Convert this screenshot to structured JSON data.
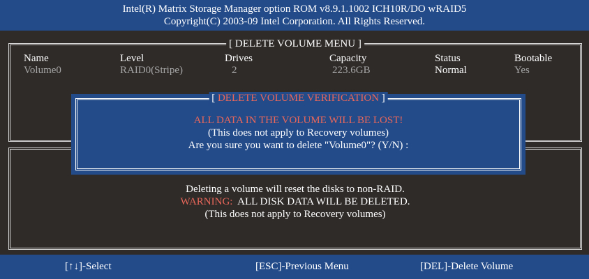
{
  "header": {
    "line1": "Intel(R) Matrix Storage Manager option ROM v8.9.1.1002 ICH10R/DO wRAID5",
    "line2": "Copyright(C) 2003-09 Intel Corporation.  All Rights Reserved."
  },
  "menu": {
    "title": "[ DELETE VOLUME MENU ]",
    "columns": {
      "name": "Name",
      "level": "Level",
      "drives": "Drives",
      "capacity": "Capacity",
      "status": "Status",
      "bootable": "Bootable"
    },
    "row": {
      "name": "Volume0",
      "level": "RAID0(Stripe)",
      "drives": "2",
      "capacity": "223.6GB",
      "status": "Normal",
      "bootable": "Yes"
    }
  },
  "dialog": {
    "bracket_open": "[ ",
    "title": "DELETE VOLUME VERIFICATION",
    "bracket_close": " ]",
    "line1": "ALL DATA IN THE VOLUME WILL BE LOST!",
    "line2": "(This does not apply to Recovery volumes)",
    "line3": "Are you sure you want to delete \"Volume0\"? (Y/N) :"
  },
  "info": {
    "line1": "Deleting a volume will reset the disks to non-RAID.",
    "warning_label": "WARNING:",
    "warning_text": "  ALL DISK DATA WILL BE DELETED.",
    "line3": "(This does not apply to Recovery volumes)"
  },
  "footer": {
    "select": "[↑↓]-Select",
    "previous": "[ESC]-Previous Menu",
    "delete": "[DEL]-Delete Volume"
  },
  "colors": {
    "background": "#2f2b29",
    "bar": "#234b8a",
    "accent": "#e9675a",
    "muted": "#a6a6a6"
  }
}
